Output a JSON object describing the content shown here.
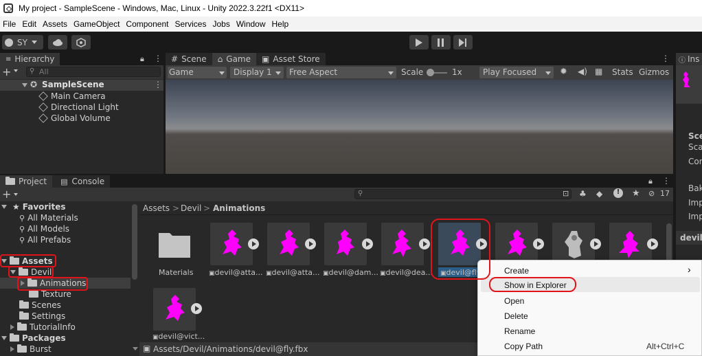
{
  "window": {
    "title": "My project - SampleScene - Windows, Mac, Linux - Unity 2022.3.22f1 <DX11>"
  },
  "menu": [
    "File",
    "Edit",
    "Assets",
    "GameObject",
    "Component",
    "Services",
    "Jobs",
    "Window",
    "Help"
  ],
  "toolbar": {
    "account": "SY"
  },
  "hierarchy": {
    "tab": "Hierarchy",
    "search_placeholder": "All",
    "scene": "SampleScene",
    "items": [
      "Main Camera",
      "Directional Light",
      "Global Volume"
    ]
  },
  "game_view": {
    "tabs": [
      "Scene",
      "Game",
      "Asset Store"
    ],
    "display_mode": "Game",
    "display": "Display 1",
    "aspect": "Free Aspect",
    "scale_label": "Scale",
    "scale_value": "1x",
    "play_mode": "Play Focused",
    "stats": "Stats",
    "gizmos": "Gizmos"
  },
  "inspector": {
    "tab": "Ins",
    "labels": [
      "Sce",
      "Sca",
      "Con",
      "Bak",
      "Imp",
      "Imp",
      "devil@"
    ]
  },
  "project": {
    "tabs": [
      "Project",
      "Console"
    ],
    "hidden_count": "17",
    "favorites": {
      "label": "Favorites",
      "items": [
        "All Materials",
        "All Models",
        "All Prefabs"
      ]
    },
    "tree": {
      "assets": "Assets",
      "devil": "Devil",
      "animations": "Animations",
      "texture": "Texture",
      "scenes": "Scenes",
      "settings": "Settings",
      "tutorial": "TutorialInfo",
      "packages": "Packages",
      "burst": "Burst"
    },
    "breadcrumb": [
      "Assets",
      "Devil",
      "Animations"
    ],
    "assets": [
      {
        "label": "Materials"
      },
      {
        "label": "devil@atta..."
      },
      {
        "label": "devil@atta..."
      },
      {
        "label": "devil@dam..."
      },
      {
        "label": "devil@dea..."
      },
      {
        "label": "devil@fly"
      },
      {
        "label": ""
      },
      {
        "label": ""
      },
      {
        "label": ""
      },
      {
        "label": "devil@vict..."
      }
    ],
    "status_path": "Assets/Devil/Animations/devil@fly.fbx"
  },
  "context_menu": {
    "items": [
      {
        "label": "Create",
        "shortcut": "›"
      },
      {
        "label": "Show in Explorer",
        "shortcut": ""
      },
      {
        "label": "Open",
        "shortcut": ""
      },
      {
        "label": "Delete",
        "shortcut": ""
      },
      {
        "label": "Rename",
        "shortcut": ""
      },
      {
        "label": "Copy Path",
        "shortcut": "Alt+Ctrl+C"
      }
    ]
  },
  "colors": {
    "accent": "#e0141a",
    "magenta": "#ff00ff",
    "selection": "#2c5d87"
  }
}
